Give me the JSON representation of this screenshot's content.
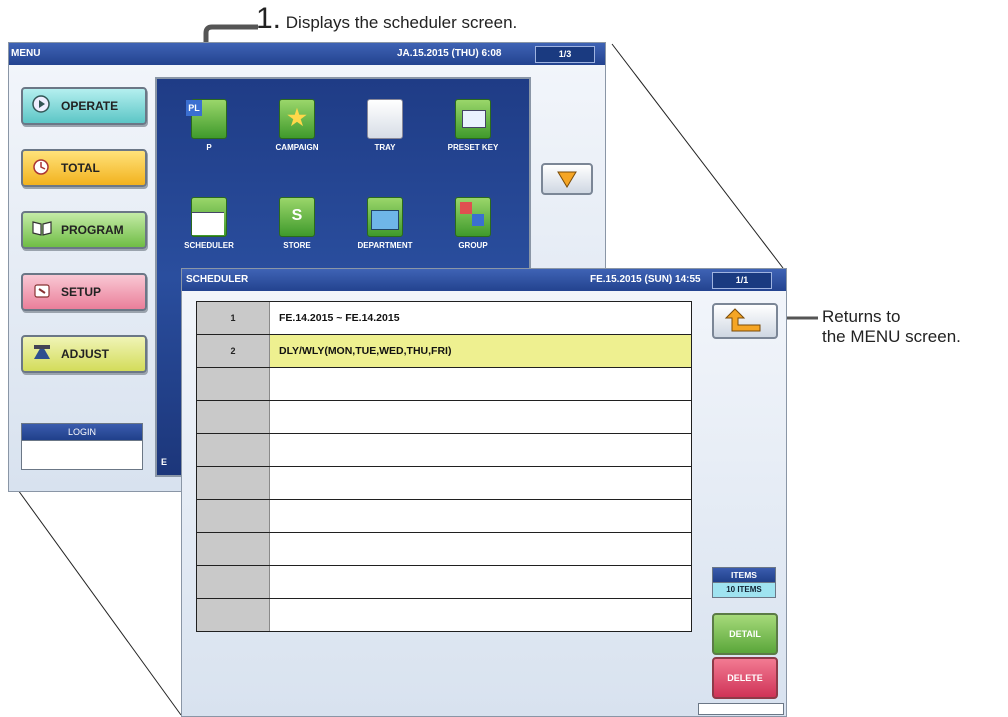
{
  "callouts": {
    "step_number": "1.",
    "step_text": "Displays the scheduler screen.",
    "return_note_line1": "Returns to",
    "return_note_line2": "the MENU screen."
  },
  "menu_screen": {
    "title": "MENU",
    "datetime": "JA.15.2015 (THU)  6:08",
    "page": "1/3",
    "side_buttons": [
      {
        "label": "OPERATE",
        "icon": "play-icon",
        "color": "#5cc6c6"
      },
      {
        "label": "TOTAL",
        "icon": "clock-icon",
        "color": "#f2c230"
      },
      {
        "label": "PROGRAM",
        "icon": "book-icon",
        "color": "#7fc65a"
      },
      {
        "label": "SETUP",
        "icon": "wrench-icon",
        "color": "#ef8fa8"
      },
      {
        "label": "ADJUST",
        "icon": "scale-icon",
        "color": "#dde66a"
      }
    ],
    "login_label": "LOGIN",
    "apps": [
      {
        "label": "P",
        "icon": "plu-icon"
      },
      {
        "label": "CAMPAIGN",
        "icon": "star-icon"
      },
      {
        "label": "TRAY",
        "icon": "tray-icon"
      },
      {
        "label": "PRESET KEY",
        "icon": "preset-key-icon"
      },
      {
        "label": "SCHEDULER",
        "icon": "calendar-icon"
      },
      {
        "label": "STORE",
        "icon": "store-icon"
      },
      {
        "label": "DEPARTMENT",
        "icon": "folder-icon"
      },
      {
        "label": "GROUP",
        "icon": "group-icon"
      }
    ],
    "clipped_char": "E"
  },
  "scheduler_screen": {
    "title": "SCHEDULER",
    "datetime": "FE.15.2015 (SUN)  14:55",
    "page": "1/1",
    "rows": [
      {
        "num": "1",
        "text": "FE.14.2015 ~ FE.14.2015"
      },
      {
        "num": "2",
        "text": "DLY/WLY(MON,TUE,WED,THU,FRI)"
      },
      {
        "num": "",
        "text": ""
      },
      {
        "num": "",
        "text": ""
      },
      {
        "num": "",
        "text": ""
      },
      {
        "num": "",
        "text": ""
      },
      {
        "num": "",
        "text": ""
      },
      {
        "num": "",
        "text": ""
      },
      {
        "num": "",
        "text": ""
      },
      {
        "num": "",
        "text": ""
      }
    ],
    "items_title": "ITEMS",
    "items_value": "10 ITEMS",
    "detail_label": "DETAIL",
    "delete_label": "DELETE"
  }
}
